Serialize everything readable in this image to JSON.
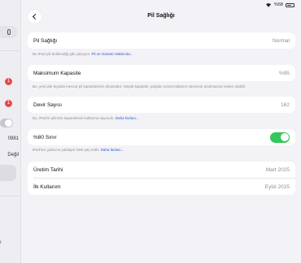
{
  "status": {
    "battery": "%58"
  },
  "sidebar": {
    "badge_1": "1",
    "badge_2": "1",
    "text_1": "0981",
    "text_2": "Değil"
  },
  "header": {
    "title": "Pil Sağlığı"
  },
  "rows": {
    "pil_sagligi": {
      "label": "Pil Sağlığı",
      "value": "Normal"
    },
    "maks": {
      "label": "Maksimum Kapasite",
      "value": "%95"
    },
    "devir": {
      "label": "Devir Sayısı",
      "value": "162"
    },
    "sinir": {
      "label": "%80 Sınır"
    },
    "uretim": {
      "label": "Üretim Tarihi",
      "value": "Mart 2025"
    },
    "ilk": {
      "label": "İlk Kullanım",
      "value": "Eylül 2025"
    }
  },
  "notes": {
    "pil": {
      "text": "Bu iPad pili beklendiği gibi çalışıyor. ",
      "link": "Pil ve Garanti Hakkında..."
    },
    "maks": {
      "text": "Bu, yeni pile kıyasla mevcut pil kapasitesinin ölçüsüdür. Düşük kapasite, şarjdan sonra kullanım süresinin azalmasına neden olabilir."
    },
    "devir": {
      "text": "Bu, iPad'in pilinizin kapasitesini kullanma sayısıdır. ",
      "link": "Daha fazlası..."
    },
    "sinir": {
      "text": "iPad'iniz yalnızca yaklaşık %80 şarj edilir. ",
      "link": "Daha fazlası..."
    }
  },
  "colors": {
    "toggle_on": "#34c759",
    "link": "#2a5fc9"
  }
}
